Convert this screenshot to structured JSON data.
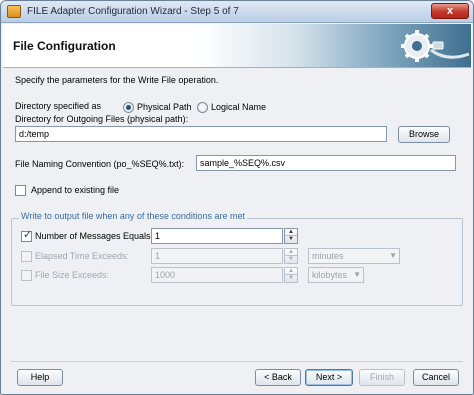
{
  "window": {
    "title": "FILE Adapter Configuration Wizard - Step 5 of 7",
    "close_label": "x"
  },
  "header": {
    "title": "File Configuration"
  },
  "description": "Specify the parameters for the Write File operation.",
  "directory_type": {
    "label": "Directory specified as",
    "options": [
      {
        "label": "Physical Path",
        "selected": true
      },
      {
        "label": "Logical Name",
        "selected": false
      }
    ]
  },
  "outgoing_dir": {
    "label": "Directory for Outgoing Files (physical path):",
    "value": "d:/temp",
    "browse_label": "Browse"
  },
  "naming": {
    "label": "File Naming Convention (po_%SEQ%.txt):",
    "value": "sample_%SEQ%.csv"
  },
  "append": {
    "label": "Append to existing file",
    "checked": false
  },
  "conditions": {
    "group_label": "Write to output file when any of these conditions are met",
    "messages": {
      "label": "Number of Messages Equals:",
      "checked": true,
      "value": "1"
    },
    "elapsed": {
      "label": "Elapsed Time Exceeds:",
      "checked": false,
      "value": "1",
      "unit": "minutes"
    },
    "size": {
      "label": "File Size Exceeds:",
      "checked": false,
      "value": "1000",
      "unit": "kilobytes"
    }
  },
  "footer": {
    "help": "Help",
    "back": "< Back",
    "next": "Next >",
    "finish": "Finish",
    "cancel": "Cancel"
  }
}
